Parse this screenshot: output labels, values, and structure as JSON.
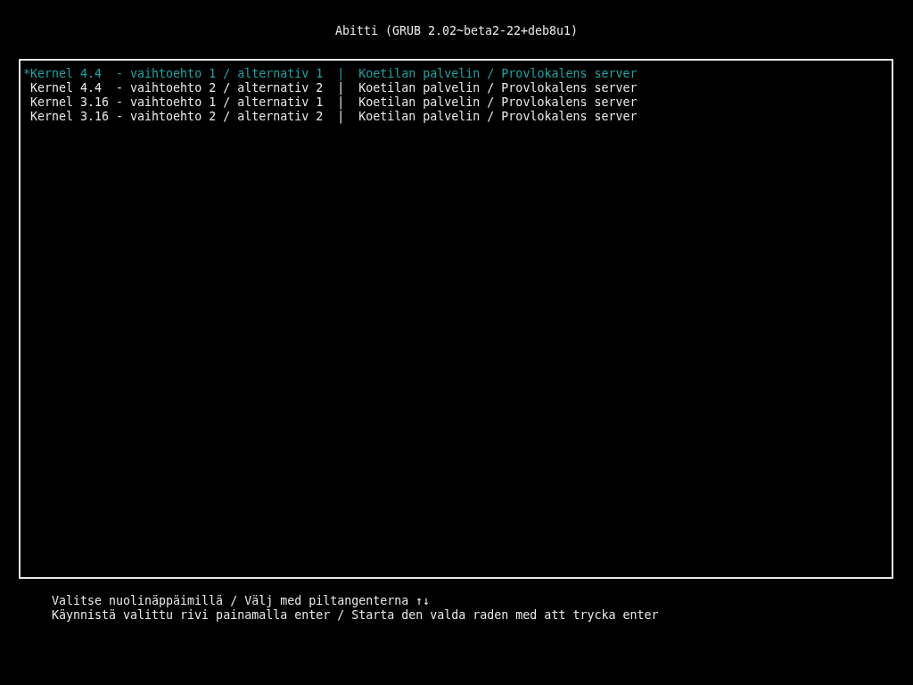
{
  "title": "Abitti (GRUB 2.02~beta2-22+deb8u1)",
  "menu": {
    "selection_marker": "*",
    "entries": [
      {
        "label": "Kernel 4.4  - vaihtoehto 1 / alternativ 1  |  Koetilan palvelin / Provlokalens server",
        "selected": true
      },
      {
        "label": "Kernel 4.4  - vaihtoehto 2 / alternativ 2  |  Koetilan palvelin / Provlokalens server",
        "selected": false
      },
      {
        "label": "Kernel 3.16 - vaihtoehto 1 / alternativ 1  |  Koetilan palvelin / Provlokalens server",
        "selected": false
      },
      {
        "label": "Kernel 3.16 - vaihtoehto 2 / alternativ 2  |  Koetilan palvelin / Provlokalens server",
        "selected": false
      }
    ]
  },
  "help": [
    "Valitse nuolinäppäimillä / Välj med piltangenterna ↑↓",
    "Käynnistä valittu rivi painamalla enter / Starta den valda raden med att trycka enter"
  ]
}
